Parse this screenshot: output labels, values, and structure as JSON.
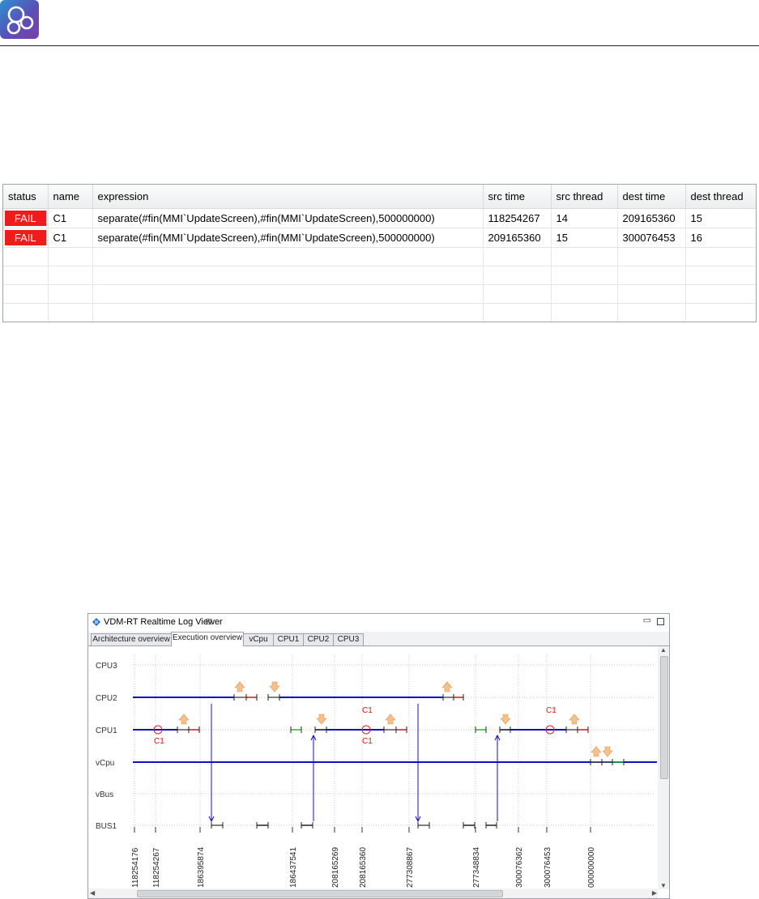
{
  "app": {
    "logo_icon": "overture-circles-logo",
    "colors": {
      "fail": "#ef1c1c",
      "lane": "#1010c8",
      "grid": "#c8c8c8"
    }
  },
  "results": {
    "columns": [
      "status",
      "name",
      "expression",
      "src time",
      "src thread",
      "dest time",
      "dest thread"
    ],
    "rows": [
      {
        "status": "FAIL",
        "name": "C1",
        "expression": "separate(#fin(MMI`UpdateScreen),#fin(MMI`UpdateScreen),500000000)",
        "src_time": "118254267",
        "src_thread": "14",
        "dest_time": "209165360",
        "dest_thread": "15"
      },
      {
        "status": "FAIL",
        "name": "C1",
        "expression": "separate(#fin(MMI`UpdateScreen),#fin(MMI`UpdateScreen),500000000)",
        "src_time": "209165360",
        "src_thread": "15",
        "dest_time": "300076453",
        "dest_thread": "16"
      }
    ]
  },
  "viewer": {
    "title": "VDM-RT Realtime Log Viewer",
    "close_glyph": "⊠",
    "tabs": [
      "Architecture overview",
      "Execution overview",
      "vCpu",
      "CPU1",
      "CPU2",
      "CPU3"
    ],
    "active_tab": 1,
    "lanes": [
      "CPU3",
      "CPU2",
      "CPU1",
      "vCpu",
      "vBus",
      "BUS1"
    ],
    "time_ticks": [
      "118254176",
      "118254267",
      "186395874",
      "186437541",
      "208165269",
      "208165360",
      "277308867",
      "277348834",
      "300076362",
      "300076453",
      "000000000"
    ],
    "violation_label": "C1"
  }
}
